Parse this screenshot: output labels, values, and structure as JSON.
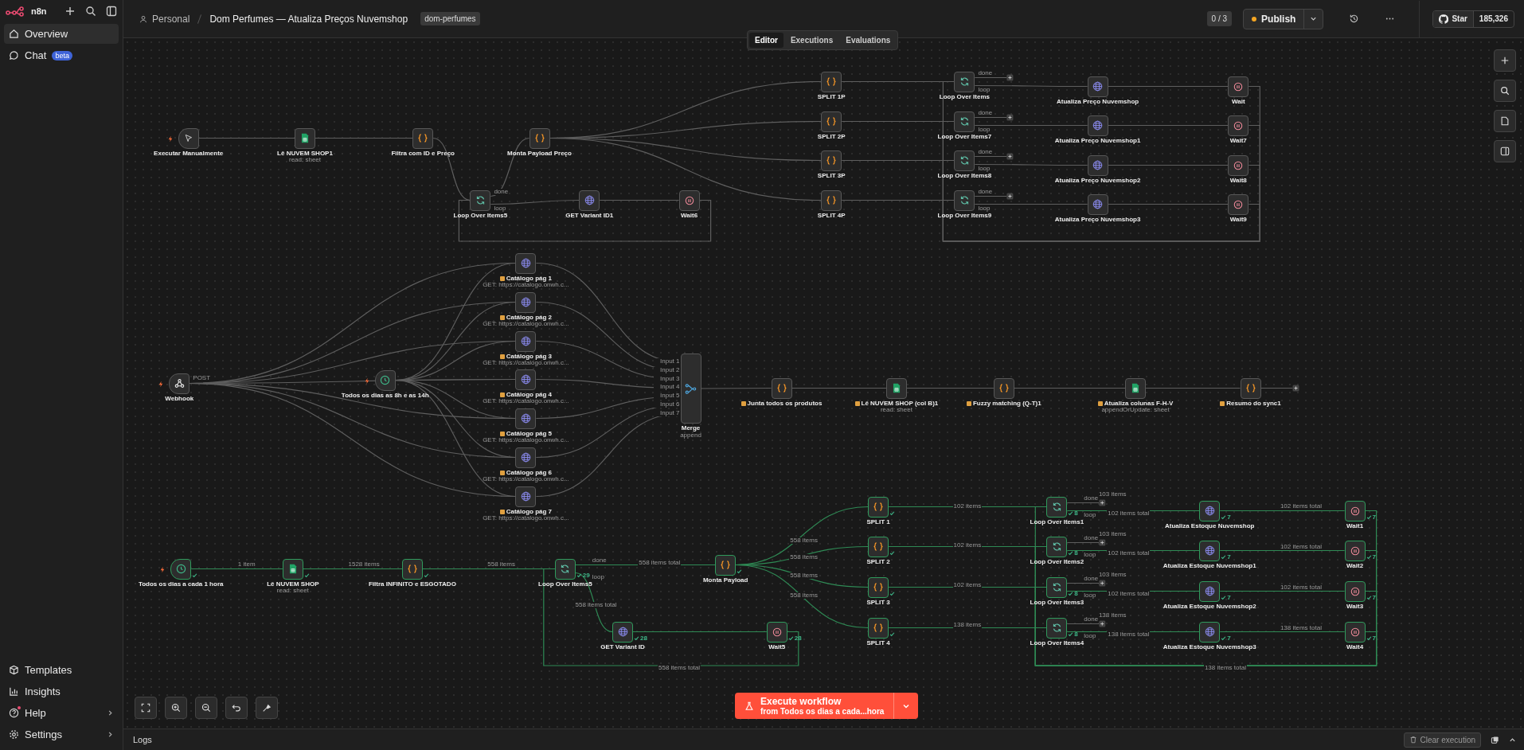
{
  "sidebar": {
    "brand": "n8n",
    "items": [
      {
        "label": "Overview",
        "selected": true
      },
      {
        "label": "Chat",
        "badge": "beta",
        "selected": false
      }
    ],
    "bottom_items": [
      {
        "label": "Templates",
        "notification": false,
        "has_submenu": false
      },
      {
        "label": "Insights",
        "notification": false,
        "has_submenu": false
      },
      {
        "label": "Help",
        "notification": true,
        "has_submenu": true
      },
      {
        "label": "Settings",
        "notification": false,
        "has_submenu": true
      }
    ]
  },
  "header": {
    "project": "Personal",
    "title": "Dom Perfumes — Atualiza Preços Nuvemshop",
    "tag": "dom-perfumes",
    "counter": "0 / 3",
    "publish": "Publish",
    "github_label": "Star",
    "github_count": "185,326"
  },
  "view_tabs": [
    {
      "label": "Editor",
      "selected": true
    },
    {
      "label": "Executions",
      "selected": false
    },
    {
      "label": "Evaluations",
      "selected": false
    }
  ],
  "nodes": [
    {
      "kind": "manual",
      "label": "Executar Manualmente",
      "executed": false
    },
    {
      "kind": "sheets",
      "label": "Lê NUVEM SHOP1",
      "subtitle": "read: sheet",
      "executed": false
    },
    {
      "kind": "code",
      "label": "Filtra com ID e Preço",
      "executed": false
    },
    {
      "kind": "code",
      "label": "Monta Payload Preço",
      "executed": false
    },
    {
      "kind": "loop",
      "label": "Loop Over Items5",
      "outputs": [
        "done",
        "loop"
      ],
      "executed": false
    },
    {
      "kind": "http",
      "label": "GET Variant ID1",
      "executed": false
    },
    {
      "kind": "wait",
      "label": "Wait6",
      "executed": false
    },
    {
      "kind": "code",
      "label": "SPLIT 1P",
      "executed": false
    },
    {
      "kind": "code",
      "label": "SPLIT 2P",
      "executed": false
    },
    {
      "kind": "code",
      "label": "SPLIT 3P",
      "executed": false
    },
    {
      "kind": "code",
      "label": "SPLIT 4P",
      "executed": false
    },
    {
      "kind": "loop",
      "label": "Loop Over Items",
      "outputs": [
        "done",
        "loop"
      ],
      "executed": false
    },
    {
      "kind": "loop",
      "label": "Loop Over Items7",
      "outputs": [
        "done",
        "loop"
      ],
      "executed": false
    },
    {
      "kind": "loop",
      "label": "Loop Over Items8",
      "outputs": [
        "done",
        "loop"
      ],
      "executed": false
    },
    {
      "kind": "loop",
      "label": "Loop Over Items9",
      "outputs": [
        "done",
        "loop"
      ],
      "executed": false
    },
    {
      "kind": "http",
      "label": "Atualiza Preço Nuvemshop",
      "executed": false
    },
    {
      "kind": "http",
      "label": "Atualiza Preço Nuvemshop1",
      "executed": false
    },
    {
      "kind": "http",
      "label": "Atualiza Preço Nuvemshop2",
      "executed": false
    },
    {
      "kind": "http",
      "label": "Atualiza Preço Nuvemshop3",
      "executed": false
    },
    {
      "kind": "wait",
      "label": "Wait",
      "executed": false
    },
    {
      "kind": "wait",
      "label": "Wait7",
      "executed": false
    },
    {
      "kind": "wait",
      "label": "Wait8",
      "executed": false
    },
    {
      "kind": "wait",
      "label": "Wait9",
      "executed": false
    },
    {
      "kind": "webhook",
      "label": "Webhook",
      "port_label": "POST",
      "executed": false
    },
    {
      "kind": "schedule",
      "label": "Todos os dias as 8h e as 14h",
      "executed": false
    },
    {
      "kind": "http",
      "label": "Catálogo pág 1",
      "label_icon": true,
      "subtitle": "GET: https://catalogo.onwh.c...",
      "executed": false
    },
    {
      "kind": "http",
      "label": "Catálogo pág 2",
      "label_icon": true,
      "subtitle": "GET: https://catalogo.onwh.c...",
      "executed": false
    },
    {
      "kind": "http",
      "label": "Catálogo pág 3",
      "label_icon": true,
      "subtitle": "GET: https://catalogo.onwh.c...",
      "executed": false
    },
    {
      "kind": "http",
      "label": "Catálogo pág 4",
      "label_icon": true,
      "subtitle": "GET: https://catalogo.onwh.c...",
      "executed": false
    },
    {
      "kind": "http",
      "label": "Catálogo pág 5",
      "label_icon": true,
      "subtitle": "GET: https://catalogo.onwh.c...",
      "executed": false
    },
    {
      "kind": "http",
      "label": "Catálogo pág 6",
      "label_icon": true,
      "subtitle": "GET: https://catalogo.onwh.c...",
      "executed": false
    },
    {
      "kind": "http",
      "label": "Catálogo pág 7",
      "label_icon": true,
      "subtitle": "GET: https://catalogo.onwh.c...",
      "executed": false
    },
    {
      "kind": "merge",
      "label": "Merge",
      "subtitle": "append",
      "inputs": [
        "Input 1",
        "Input 2",
        "Input 3",
        "Input 4",
        "Input 5",
        "Input 6",
        "Input 7"
      ],
      "executed": false
    },
    {
      "kind": "code",
      "label": "Junta todos os produtos",
      "label_icon": true,
      "executed": false
    },
    {
      "kind": "sheets",
      "label": "Lê NUVEM SHOP (col B)1",
      "label_icon": true,
      "subtitle": "read: sheet",
      "executed": false
    },
    {
      "kind": "code",
      "label": "Fuzzy matching (Q-T)1",
      "label_icon": true,
      "executed": false
    },
    {
      "kind": "sheets",
      "label": "Atualiza colunas F-H-V",
      "label_icon": true,
      "subtitle": "appendOrUpdate: sheet",
      "executed": false
    },
    {
      "kind": "code",
      "label": "Resumo do sync1",
      "label_icon": true,
      "executed": false
    },
    {
      "kind": "schedule",
      "label": "Todos os dias a cada 1 hora",
      "executed": true
    },
    {
      "kind": "sheets",
      "label": "Lê NUVEM SHOP",
      "subtitle": "read: sheet",
      "executed": true
    },
    {
      "kind": "code",
      "label": "Filtra INFINITO e ESGOTADO",
      "executed": true
    },
    {
      "kind": "loop",
      "label": "Loop Over Items5",
      "outputs": [
        "done",
        "loop"
      ],
      "executed": true,
      "count": "29"
    },
    {
      "kind": "code",
      "label": "Monta Payload",
      "executed": true
    },
    {
      "kind": "http",
      "label": "GET Variant ID",
      "executed": true,
      "count": "28"
    },
    {
      "kind": "wait",
      "label": "Wait5",
      "executed": true,
      "count": "28"
    },
    {
      "kind": "code",
      "label": "SPLIT 1",
      "executed": true
    },
    {
      "kind": "code",
      "label": "SPLIT 2",
      "executed": true
    },
    {
      "kind": "code",
      "label": "SPLIT 3",
      "executed": true
    },
    {
      "kind": "code",
      "label": "SPLIT 4",
      "executed": true
    },
    {
      "kind": "loop",
      "label": "Loop Over Items1",
      "outputs": [
        "done",
        "loop"
      ],
      "executed": true,
      "count": "8"
    },
    {
      "kind": "loop",
      "label": "Loop Over Items2",
      "outputs": [
        "done",
        "loop"
      ],
      "executed": true,
      "count": "8"
    },
    {
      "kind": "loop",
      "label": "Loop Over Items3",
      "outputs": [
        "done",
        "loop"
      ],
      "executed": true,
      "count": "8"
    },
    {
      "kind": "loop",
      "label": "Loop Over Items4",
      "outputs": [
        "done",
        "loop"
      ],
      "executed": true,
      "count": "8"
    },
    {
      "kind": "http",
      "label": "Atualiza Estoque Nuvemshop",
      "executed": true,
      "count": "7"
    },
    {
      "kind": "http",
      "label": "Atualiza Estoque Nuvemshop1",
      "executed": true,
      "count": "7"
    },
    {
      "kind": "http",
      "label": "Atualiza Estoque Nuvemshop2",
      "executed": true,
      "count": "7"
    },
    {
      "kind": "http",
      "label": "Atualiza Estoque Nuvemshop3",
      "executed": true,
      "count": "7"
    },
    {
      "kind": "wait",
      "label": "Wait1",
      "executed": true,
      "count": "7"
    },
    {
      "kind": "wait",
      "label": "Wait2",
      "executed": true,
      "count": "7"
    },
    {
      "kind": "wait",
      "label": "Wait3",
      "executed": true,
      "count": "7"
    },
    {
      "kind": "wait",
      "label": "Wait4",
      "executed": true,
      "count": "7"
    }
  ],
  "edge_labels": [
    "103 items",
    "102 items",
    "102 items total",
    "102 items total",
    "103 items",
    "558 items",
    "102 items",
    "102 items total",
    "102 items total",
    "558 items",
    "1 item",
    "1528 items",
    "558 items",
    "558 items total",
    "558 items",
    "103 items",
    "102 items",
    "102 items total",
    "102 items total",
    "558 items",
    "558 items total",
    "138 items",
    "138 items",
    "138 items total",
    "138 items total",
    "558 items total",
    "138 items total"
  ],
  "execute_button": {
    "label": "Execute workflow",
    "sublabel": "from Todos os dias a cada...hora"
  },
  "logs_bar": {
    "label": "Logs",
    "clear": "Clear execution"
  }
}
